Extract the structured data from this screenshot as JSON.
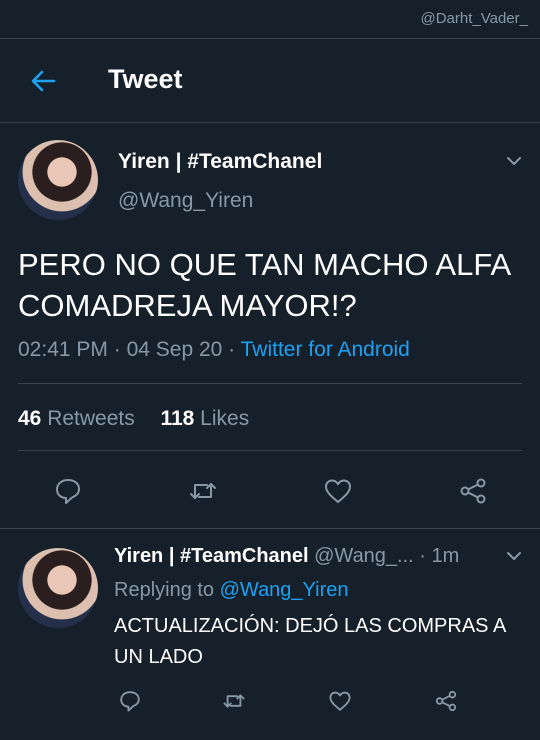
{
  "watermark": "@Darht_Vader_",
  "header": {
    "title": "Tweet"
  },
  "main_tweet": {
    "display_name": "Yiren | #TeamChanel",
    "handle": "@Wang_Yiren",
    "text": "PERO NO QUE TAN MACHO ALFA COMADREJA MAYOR!?",
    "time": "02:41 PM",
    "date": "04 Sep 20",
    "source": "Twitter for Android",
    "retweets_count": "46",
    "retweets_label": "Retweets",
    "likes_count": "118",
    "likes_label": "Likes"
  },
  "reply_tweet": {
    "display_name": "Yiren | #TeamChanel",
    "handle": "@Wang_...",
    "age": "1m",
    "replying_prefix": "Replying to",
    "replying_to": "@Wang_Yiren",
    "text": "ACTUALIZACIÓN: DEJÓ LAS COMPRAS A UN LADO"
  },
  "icons": [
    "back-arrow-icon",
    "chevron-down-icon",
    "reply-icon",
    "retweet-icon",
    "like-icon",
    "share-icon"
  ],
  "colors": {
    "background": "#15202b",
    "accent": "#1da1f2",
    "muted": "#8899a6",
    "divider": "#38444d"
  }
}
